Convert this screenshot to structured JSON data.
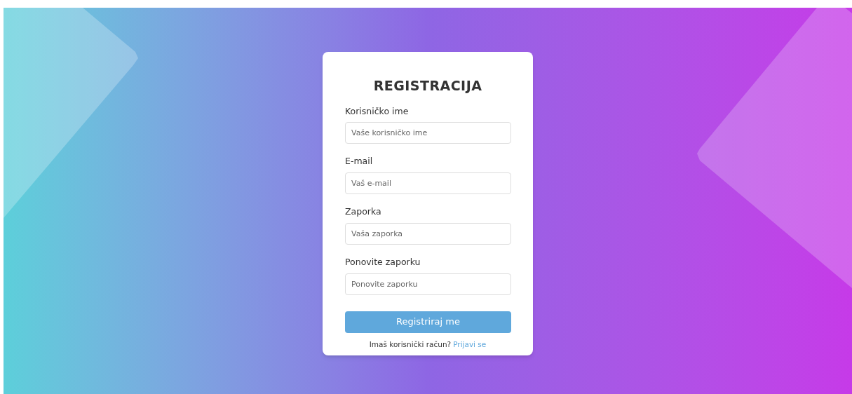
{
  "form": {
    "title": "REGISTRACIJA",
    "fields": [
      {
        "label": "Korisničko ime",
        "placeholder": "Vaše korisničko ime"
      },
      {
        "label": "E-mail",
        "placeholder": "Vaš e-mail"
      },
      {
        "label": "Zaporka",
        "placeholder": "Vaša zaporka"
      },
      {
        "label": "Ponovite zaporku",
        "placeholder": "Ponovite zaporku"
      }
    ],
    "submit": "Registriraj me",
    "footer": {
      "text": "Imaš korisnički račun?",
      "link": "Prijavi se"
    }
  }
}
